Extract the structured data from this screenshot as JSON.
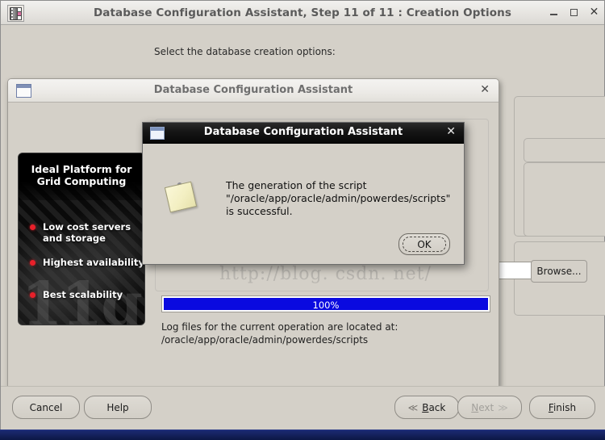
{
  "outer_window": {
    "title": "Database Configuration Assistant, Step 11 of 11 : Creation Options",
    "icon": "oracle-app-icon",
    "controls": {
      "minimize": "minimize-icon",
      "maximize": "maximize-icon",
      "close": "✕"
    }
  },
  "background_page": {
    "prompt": "Select the database creation options:",
    "browse_label": "Browse...",
    "field_value": ""
  },
  "wizard_buttons": {
    "cancel": "Cancel",
    "help": "Help",
    "back": "Back",
    "back_arrow": "≪",
    "next": "Next",
    "next_arrow": "≫",
    "finish": "Finish",
    "next_enabled": "false"
  },
  "mid_dialog": {
    "title": "Database Configuration Assistant",
    "icon": "window-icon",
    "close": "✕",
    "branding": {
      "title_line1": "Ideal Platform for",
      "title_line2": "Grid Computing",
      "watermark": "11g",
      "bullets": [
        "Low cost servers and storage",
        "Highest availability",
        "Best scalability"
      ]
    },
    "progress": {
      "percent_label": "100%",
      "percent_value": 100
    },
    "log_line1": "Log files for the current operation are located at:",
    "log_line2": "/oracle/app/oracle/admin/powerdes/scripts"
  },
  "watermark": {
    "text": "http://blog. csdn. net/"
  },
  "modal": {
    "title": "Database Configuration Assistant",
    "icon": "window-icon",
    "close": "✕",
    "note_icon": "sticky-note-icon",
    "message": "The generation of the script \"/oracle/app/oracle/admin/powerdes/scripts\" is successful.",
    "ok_label": "OK"
  },
  "colors": {
    "dialog_face": "#d4d0c8",
    "progress_fill": "#0a0ae0",
    "brand_bullet": "#e8202a",
    "desktop": "#12205c"
  }
}
